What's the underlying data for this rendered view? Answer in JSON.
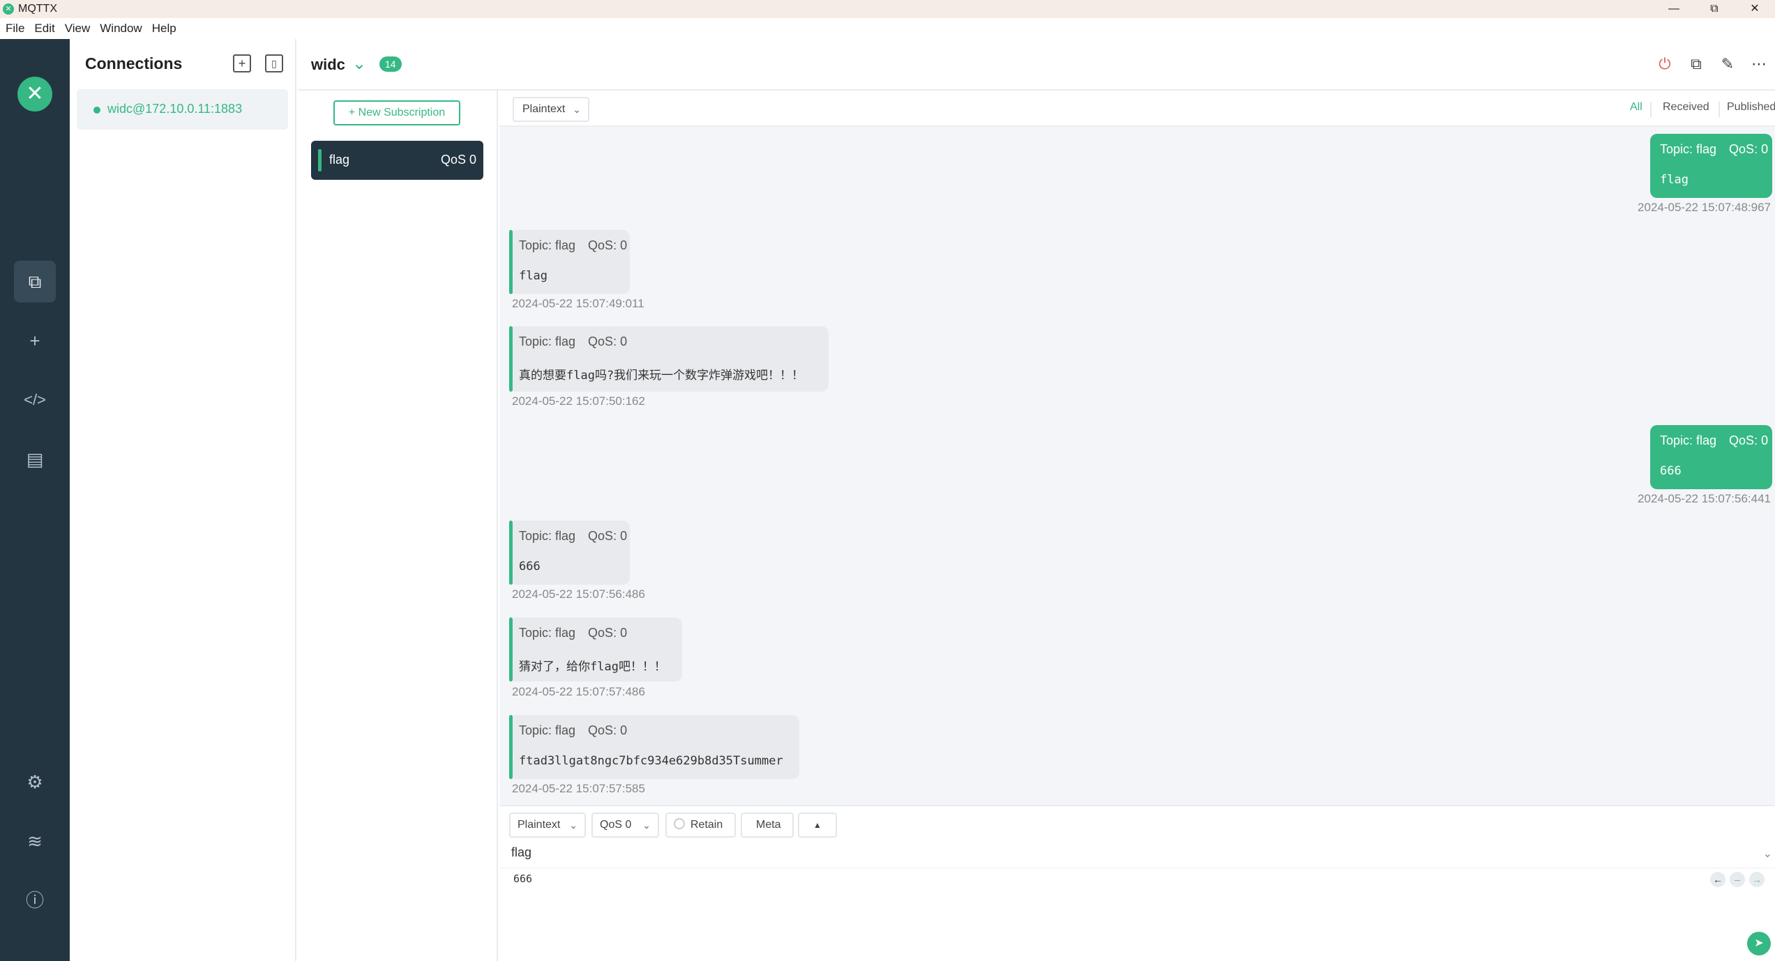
{
  "window": {
    "title": "MQTTX",
    "controls": [
      "—",
      "⧉",
      "✕"
    ]
  },
  "menu": [
    "File",
    "Edit",
    "View",
    "Window",
    "Help"
  ],
  "connections": {
    "title": "Connections",
    "items": [
      {
        "label": "widc@172.10.0.11:1883",
        "status": "connected"
      }
    ]
  },
  "header": {
    "name": "widc",
    "badge": "14"
  },
  "subscriptions": {
    "new_label": "New Subscription",
    "items": [
      {
        "topic": "flag",
        "qos": "QoS 0"
      }
    ]
  },
  "filters": {
    "format": "Plaintext",
    "all": "All",
    "received": "Received",
    "published": "Published"
  },
  "messages": [
    {
      "kind": "pub",
      "topic_label": "Topic: flag",
      "qos_label": "QoS: 0",
      "payload": "flag",
      "time": "2024-05-22 15:07:48:967"
    },
    {
      "kind": "recv",
      "topic_label": "Topic: flag",
      "qos_label": "QoS: 0",
      "payload": "flag",
      "time": "2024-05-22 15:07:49:011"
    },
    {
      "kind": "recv",
      "topic_label": "Topic: flag",
      "qos_label": "QoS: 0",
      "payload": "真的想要flag吗?我们来玩一个数字炸弹游戏吧！！！",
      "time": "2024-05-22 15:07:50:162"
    },
    {
      "kind": "pub",
      "topic_label": "Topic: flag",
      "qos_label": "QoS: 0",
      "payload": "666",
      "time": "2024-05-22 15:07:56:441"
    },
    {
      "kind": "recv",
      "topic_label": "Topic: flag",
      "qos_label": "QoS: 0",
      "payload": "666",
      "time": "2024-05-22 15:07:56:486"
    },
    {
      "kind": "recv",
      "topic_label": "Topic: flag",
      "qos_label": "QoS: 0",
      "payload": "猜对了，给你flag吧！！！",
      "time": "2024-05-22 15:07:57:486"
    },
    {
      "kind": "recv",
      "topic_label": "Topic: flag",
      "qos_label": "QoS: 0",
      "payload": "ftad3llgat8ngc7bfc934e629b8d35Tsummer",
      "time": "2024-05-22 15:07:57:585"
    }
  ],
  "compose": {
    "format": "Plaintext",
    "qos": "QoS 0",
    "retain": "Retain",
    "meta": "Meta",
    "topic": "flag",
    "payload": "666"
  },
  "colors": {
    "accent": "#35b883",
    "nav_bg": "#233541"
  }
}
